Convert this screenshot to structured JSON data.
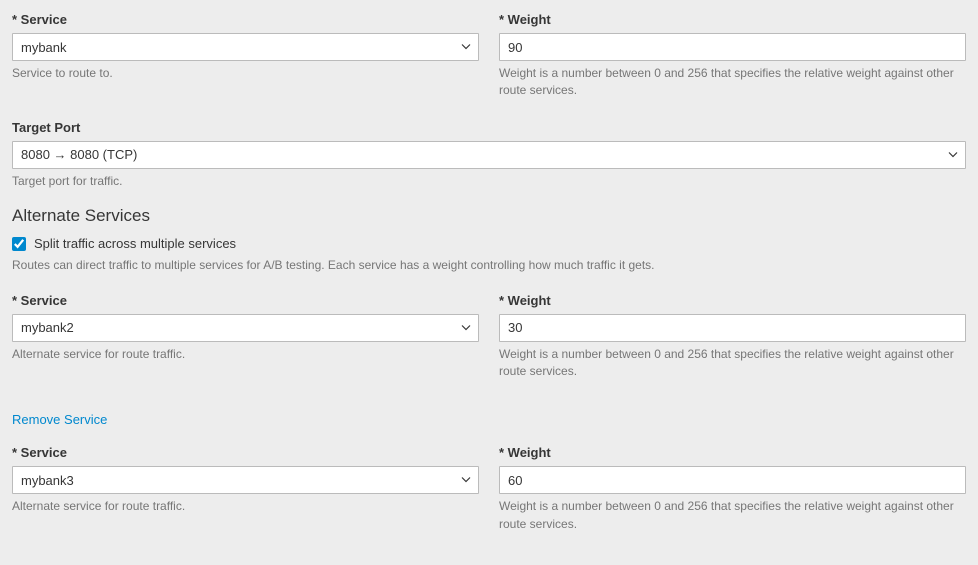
{
  "primary_service": {
    "label": "* Service",
    "value": "mybank",
    "help": "Service to route to."
  },
  "primary_weight": {
    "label": "* Weight",
    "value": "90",
    "help": "Weight is a number between 0 and 256 that specifies the relative weight against other route services."
  },
  "target_port": {
    "label": "Target Port",
    "value": "8080 → 8080 (TCP)",
    "help": "Target port for traffic."
  },
  "alternate": {
    "title": "Alternate Services",
    "split_label": "Split traffic across multiple services",
    "split_checked": true,
    "help": "Routes can direct traffic to multiple services for A/B testing. Each service has a weight controlling how much traffic it gets."
  },
  "alt_service_1": {
    "label": "* Service",
    "value": "mybank2",
    "help": "Alternate service for route traffic."
  },
  "alt_weight_1": {
    "label": "* Weight",
    "value": "30",
    "help": "Weight is a number between 0 and 256 that specifies the relative weight against other route services."
  },
  "remove_label": "Remove Service",
  "alt_service_2": {
    "label": "* Service",
    "value": "mybank3",
    "help": "Alternate service for route traffic."
  },
  "alt_weight_2": {
    "label": "* Weight",
    "value": "60",
    "help": "Weight is a number between 0 and 256 that specifies the relative weight against other route services."
  }
}
